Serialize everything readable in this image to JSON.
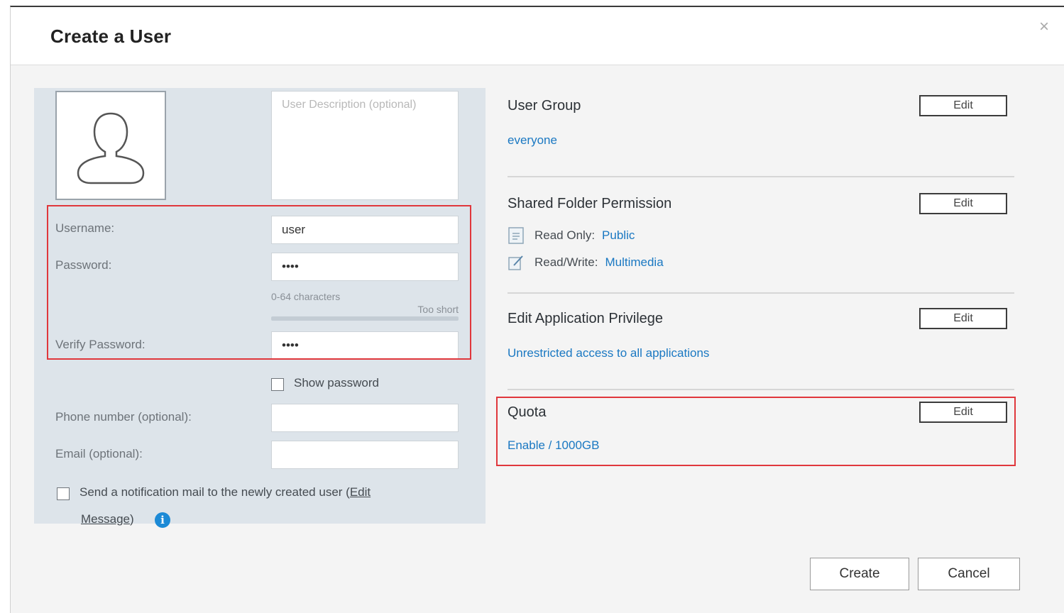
{
  "dialog": {
    "title": "Create a User",
    "close_glyph": "×"
  },
  "left": {
    "description_placeholder": "User Description (optional)",
    "username_label": "Username:",
    "username_value": "user",
    "password_label": "Password:",
    "password_value": "••••",
    "password_hint": "0-64 characters",
    "password_strength": "Too short",
    "password_strength_fill": 0.0,
    "verify_label": "Verify Password:",
    "verify_value": "••••",
    "show_password_label": "Show password",
    "phone_label": "Phone number (optional):",
    "email_label": "Email (optional):",
    "notify_label": "Send a notification mail to the newly created user (",
    "notify_edit": "Edit",
    "notify_message": "Message",
    "notify_close": ")",
    "info_glyph": "i"
  },
  "right": {
    "user_group": {
      "title": "User Group",
      "edit_label": "Edit",
      "value": "everyone"
    },
    "shared_folder": {
      "title": "Shared Folder Permission",
      "edit_label": "Edit",
      "read_only_label": "Read Only:",
      "read_only_value": "Public",
      "read_write_label": "Read/Write:",
      "read_write_value": "Multimedia"
    },
    "app_privilege": {
      "title": "Edit Application Privilege",
      "edit_label": "Edit",
      "value": "Unrestricted access to all applications"
    },
    "quota": {
      "title": "Quota",
      "edit_label": "Edit",
      "value": "Enable / 1000GB"
    }
  },
  "footer": {
    "create_label": "Create",
    "cancel_label": "Cancel"
  },
  "colors": {
    "highlight_red": "#e0373c",
    "link_blue": "#1a78c2",
    "panel_bg": "#dde4ea"
  },
  "icons": {
    "avatar": "user-silhouette-icon",
    "read_only": "document-icon",
    "read_write": "edit-pencil-icon",
    "info": "info-circle-icon",
    "close": "close-icon"
  }
}
